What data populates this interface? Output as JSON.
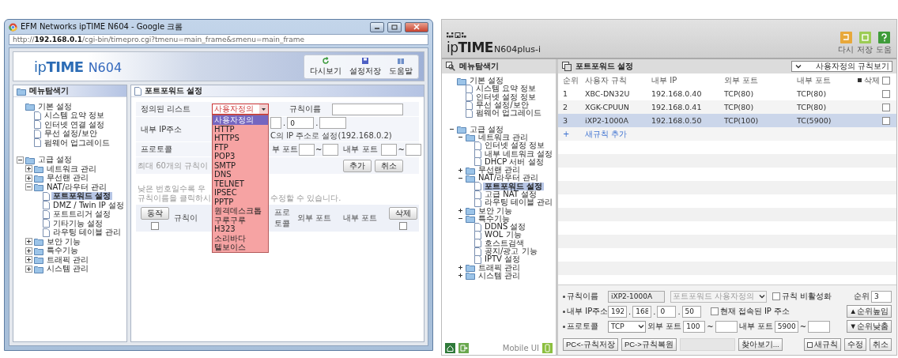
{
  "left_window": {
    "title": "EFM Networks ipTIME N604 - Google 크롬",
    "address": "http://**192.168.0.1**/cgi-bin/timepro.cgi?tmenu=main_frame&smenu=main_frame",
    "logo": {
      "brand": "ip**TIME**",
      "model": "N604"
    },
    "toolbar": [
      {
        "label": "다시보기"
      },
      {
        "label": "설정저장"
      },
      {
        "label": "도움말"
      }
    ],
    "sidebar": {
      "title": "메뉴탐색기",
      "tree": [
        {
          "label": "기본 설정",
          "selected": false,
          "children": [
            {
              "label": "시스템 요약 정보",
              "selected": false
            },
            {
              "label": "인터넷 연결 설정",
              "selected": false
            },
            {
              "label": "무선 설정/보안",
              "selected": false
            },
            {
              "label": "펌웨어 업그레이드",
              "selected": false
            }
          ]
        },
        {
          "label": "고급 설정",
          "selected": false,
          "expanded": true,
          "children": [
            {
              "label": "네트워크 관리",
              "selected": false,
              "expanded": false
            },
            {
              "label": "무선랜 관리",
              "selected": false,
              "expanded": false
            },
            {
              "label": "NAT/라우터 관리",
              "selected": false,
              "expanded": true,
              "children": [
                {
                  "label": "포트포워드 설정",
                  "selected": true
                },
                {
                  "label": "DMZ / Twin IP 설정",
                  "selected": false
                },
                {
                  "label": "포트트리거 설정",
                  "selected": false
                },
                {
                  "label": "기타기능 설정",
                  "selected": false
                },
                {
                  "label": "라우팅 테이블 관리",
                  "selected": false
                }
              ]
            },
            {
              "label": "보안 기능",
              "selected": false,
              "expanded": false
            },
            {
              "label": "특수기능",
              "selected": false,
              "expanded": false
            },
            {
              "label": "트래픽 관리",
              "selected": false,
              "expanded": false
            },
            {
              "label": "시스템 관리",
              "selected": false,
              "expanded": false
            }
          ]
        }
      ]
    },
    "panel": {
      "title": "포트포워드 설정",
      "list_label": "정의된 리스트",
      "list_select": "사용자정의",
      "list_options": [
        {
          "label": "사용자정의",
          "selected": true
        },
        {
          "label": "HTTP",
          "selected": false
        },
        {
          "label": "HTTPS",
          "selected": false
        },
        {
          "label": "FTP",
          "selected": false
        },
        {
          "label": "POP3",
          "selected": false
        },
        {
          "label": "SMTP",
          "selected": false
        },
        {
          "label": "DNS",
          "selected": false
        },
        {
          "label": "TELNET",
          "selected": false
        },
        {
          "label": "IPSEC",
          "selected": false
        },
        {
          "label": "PPTP",
          "selected": false
        },
        {
          "label": "원격데스크톱",
          "selected": false
        },
        {
          "label": "구루구루",
          "selected": false
        },
        {
          "label": "H323",
          "selected": false
        },
        {
          "label": "소리바다",
          "selected": false
        },
        {
          "label": "텔보이스",
          "selected": false
        }
      ],
      "rule_name_label": "규칙이름",
      "ip_label": "내부 IP주소",
      "ip_value": "0",
      "ip_separators": [
        ".",
        "."
      ],
      "ip_note": "C의 IP 주소로 설정(192.168.0.2)",
      "protocol_label": "프로토콜",
      "external_port_label": "부 포트",
      "external_sep": "~",
      "internal_port_label": "내부 포트",
      "internal_sep": "~",
      "limit_note": "최대 60개의 규칙이",
      "buttons": [
        "추가",
        "취소"
      ],
      "hint_lines": [
        [
          "낮은 번호일수록 우"
        ],
        [
          "규칙이름을 클릭하시",
          "수정할 수 있습니다."
        ]
      ],
      "table_header": {
        "action": "동작",
        "action_checked": false,
        "rule": "규칙이",
        "protocol": "프로토콜",
        "external": "외부 포트",
        "internal": "내부 포트",
        "delete": "삭제",
        "delete_checked": false
      }
    }
  },
  "right_window": {
    "logo": {
      "brand": "ip**TIME**",
      "model": "N604plus-i"
    },
    "toolbar": [
      {
        "label": "다시"
      },
      {
        "label": "저장"
      },
      {
        "label": "도움"
      }
    ],
    "sidebar": {
      "title": "메뉴탐색기",
      "tree": [
        {
          "label": "기본 설정",
          "selected": false,
          "children": [
            {
              "label": "시스템 요약 정보",
              "selected": false
            },
            {
              "label": "인터넷 설정 정보",
              "selected": false
            },
            {
              "label": "무선 설정/보안",
              "selected": false
            },
            {
              "label": "펌웨어 업그레이드",
              "selected": false
            }
          ]
        },
        {
          "label": "고급 설정",
          "selected": false,
          "expanded": true,
          "children": [
            {
              "label": "네트워크 관리",
              "selected": false,
              "expanded": true,
              "children": [
                {
                  "label": "인터넷 설정 정보",
                  "selected": false
                },
                {
                  "label": "내부 네트워크 설정",
                  "selected": false
                },
                {
                  "label": "DHCP 서버 설정",
                  "selected": false
                }
              ]
            },
            {
              "label": "무선랜 관리",
              "selected": false,
              "expanded": false
            },
            {
              "label": "NAT/라우터 관리",
              "selected": false,
              "expanded": true,
              "children": [
                {
                  "label": "포트포워드 설정",
                  "selected": true
                },
                {
                  "label": "고급 NAT 설정",
                  "selected": false
                },
                {
                  "label": "라우팅 테이블 관리",
                  "selected": false
                }
              ]
            },
            {
              "label": "보안 기능",
              "selected": false,
              "expanded": false
            },
            {
              "label": "특수기능",
              "selected": false,
              "expanded": true,
              "children": [
                {
                  "label": "DDNS 설정",
                  "selected": false
                },
                {
                  "label": "WOL 기능",
                  "selected": false
                },
                {
                  "label": "호스트검색",
                  "selected": false
                },
                {
                  "label": "공지/광고 기능",
                  "selected": false
                },
                {
                  "label": "IPTV 설정",
                  "selected": false
                }
              ]
            },
            {
              "label": "트래픽 관리",
              "selected": false,
              "expanded": false
            },
            {
              "label": "시스템 관리",
              "selected": false,
              "expanded": false
            }
          ]
        }
      ],
      "footer_label": "Mobile UI"
    },
    "panel": {
      "title": "포트포워드 설정",
      "filter": "사용자정의 규칙보기",
      "columns": [
        "순위",
        "사용자 규칙",
        "내부 IP",
        "외부 포트",
        "내부 포트",
        "삭제"
      ],
      "delete_all_checked": false,
      "rows": [
        {
          "rank": "1",
          "name": "XBC-DN32U",
          "ip": "192.168.0.40",
          "external": "TCP(80)",
          "internal": "TCP(80)",
          "checked": false,
          "selected": false
        },
        {
          "rank": "2",
          "name": "XGK-CPUUN",
          "ip": "192.168.0.41",
          "external": "TCP(80)",
          "internal": "TCP(80)",
          "checked": false,
          "selected": false
        },
        {
          "rank": "3",
          "name": "iXP2-1000A",
          "ip": "192.168.0.50",
          "external": "TCP(100)",
          "internal": "TC(5900)",
          "checked": false,
          "selected": true
        }
      ],
      "add_mark": "+",
      "add_rule": "새규칙 추가",
      "form": {
        "name_label": "규칙이름",
        "name_value": "iXP2-1000A",
        "preset": "포트포워드 사용자정의",
        "disable_label": "규칙 비활성화",
        "disable_checked": false,
        "ip_label": "내부 IP주소",
        "ip": [
          "192",
          "168",
          "0",
          "50"
        ],
        "ip_separators": [
          ".",
          ".",
          "."
        ],
        "current_ip_label": "현재 접속된 IP 주소",
        "current_ip_checked": false,
        "protocol_label": "프로토콜",
        "protocol": "TCP",
        "external_label": "외부 포트",
        "external_from": "100",
        "external_sep": "~",
        "internal_label": "내부 포트",
        "internal_from": "5900",
        "internal_sep": "~",
        "rank_label": "순위",
        "rank_value": "3",
        "rank_up": "▲순위높임",
        "rank_down": "▼순위낮춤"
      },
      "buttons": {
        "save": "PC<-규칙저장",
        "restore": "PC->규칙복원",
        "browse": "찾아보기...",
        "new": "새규칙",
        "edit": "수정",
        "cancel": "취소"
      }
    }
  }
}
